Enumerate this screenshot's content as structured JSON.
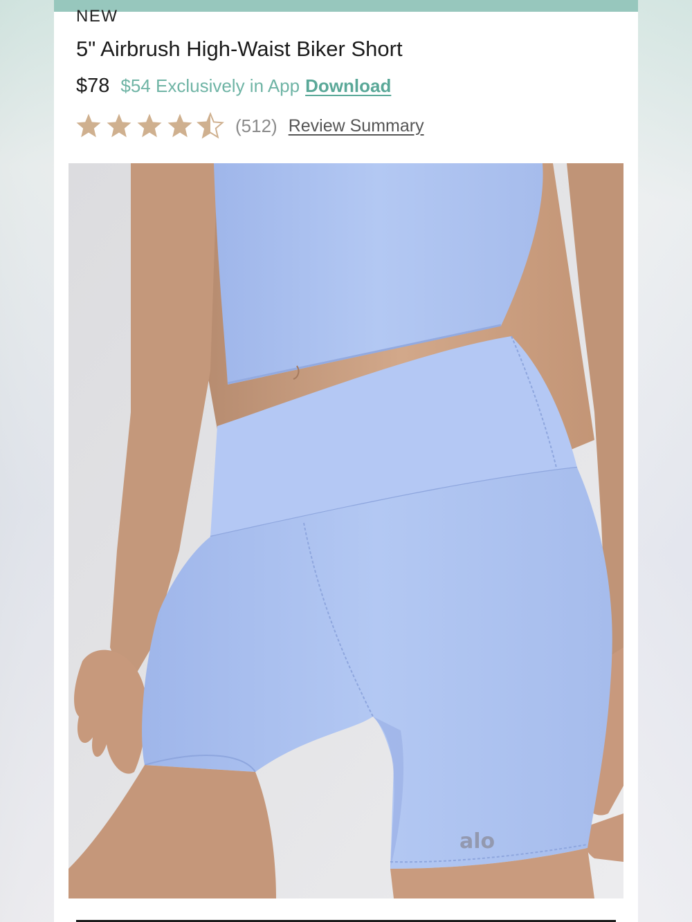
{
  "product": {
    "badge": "NEW",
    "title": "5\" Airbrush High-Waist Biker Short",
    "price": "$78",
    "app_price": "$54 Exclusively in App",
    "download_label": "Download",
    "rating": 4.5,
    "rating_max": 5,
    "review_count": "(512)",
    "review_summary_label": "Review Summary",
    "image_brand_mark": "alo"
  },
  "colors": {
    "accent_bar": "#97c7bd",
    "app_price": "#6fb4a5",
    "download_link": "#5aa898",
    "star": "#cfb08f",
    "garment": "#aec3ee"
  }
}
